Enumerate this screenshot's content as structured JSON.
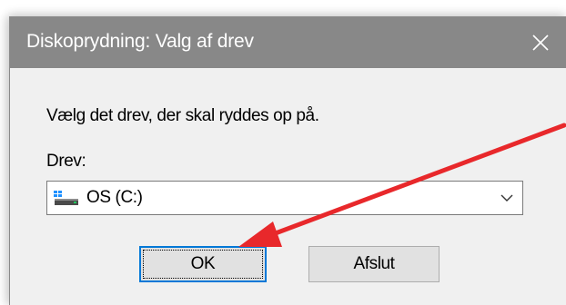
{
  "window": {
    "title": "Diskoprydning: Valg af drev",
    "close_glyph": "✕"
  },
  "dialog": {
    "instruction": "Vælg det drev, der skal ryddes op på.",
    "drive_label": "Drev:",
    "drive_select": {
      "selected": "OS (C:)",
      "icon": "windows-drive-icon"
    },
    "ok_label": "OK",
    "exit_label": "Afslut"
  },
  "annotation": {
    "arrow_color": "#e8282b",
    "target": "ok-button"
  },
  "colors": {
    "titlebar": "#888888",
    "client": "#f0f0f0",
    "focus": "#0078d7"
  }
}
